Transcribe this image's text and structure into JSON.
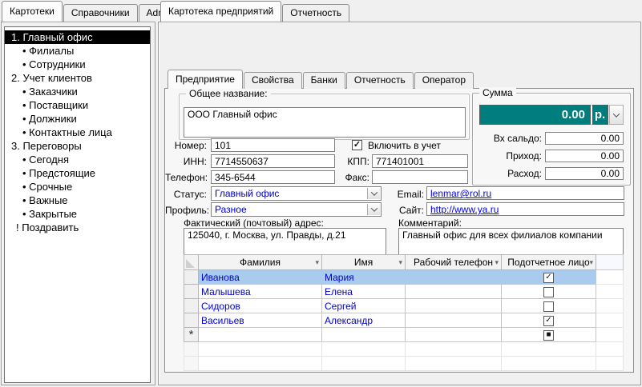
{
  "colors": {
    "accent_teal": "#007d7d",
    "selection_blue": "#a9cbee",
    "value_blue": "#0000cd",
    "link_blue": "#0000ee",
    "tree_selected_bg": "#000000"
  },
  "left_tabs": {
    "items": [
      {
        "label": "Картотеки",
        "active": true
      },
      {
        "label": "Справочники",
        "active": false
      },
      {
        "label": "Admin",
        "active": false
      }
    ]
  },
  "right_tabs": {
    "items": [
      {
        "label": "Картотека предприятий",
        "active": true
      },
      {
        "label": "Отчетность",
        "active": false
      }
    ]
  },
  "tree": {
    "items": [
      {
        "label": "1. Главный офис",
        "selected": true
      },
      {
        "label": "• Филиалы"
      },
      {
        "label": "• Сотрудники"
      },
      {
        "label": "2. Учет клиентов"
      },
      {
        "label": "• Заказчики"
      },
      {
        "label": "• Поставщики"
      },
      {
        "label": "• Должники"
      },
      {
        "label": "• Контактные лица"
      },
      {
        "label": "3. Переговоры"
      },
      {
        "label": "• Сегодня"
      },
      {
        "label": "• Предстоящие"
      },
      {
        "label": "• Срочные"
      },
      {
        "label": "• Важные"
      },
      {
        "label": "• Закрытые"
      },
      {
        "label": "! Поздравить"
      }
    ]
  },
  "inner_tabs": {
    "items": [
      {
        "label": "Предприятие",
        "active": true
      },
      {
        "label": "Свойства",
        "active": false
      },
      {
        "label": "Банки",
        "active": false
      },
      {
        "label": "Отчетность",
        "active": false
      },
      {
        "label": "Оператор",
        "active": false
      }
    ]
  },
  "form": {
    "general_name": {
      "legend": "Общее название:",
      "value": "ООО Главный офис"
    },
    "number": {
      "label": "Номер:",
      "value": "101"
    },
    "include": {
      "label": "Включить в учет",
      "checked": true
    },
    "inn": {
      "label": "ИНН:",
      "value": "7714550637"
    },
    "kpp": {
      "label": "КПП:",
      "value": "771401001"
    },
    "phone": {
      "label": "Телефон:",
      "value": "345-6544"
    },
    "fax": {
      "label": "Факс:",
      "value": ""
    },
    "status": {
      "label": "Статус:",
      "value": "Главный офис"
    },
    "profile": {
      "label": "Профиль:",
      "value": "Разное"
    },
    "email": {
      "label": "Email:",
      "value": "lenmar@rol.ru"
    },
    "site": {
      "label": "Сайт:",
      "value": "http://www.ya.ru"
    },
    "address": {
      "label": "Фактический (почтовый) адрес:",
      "value": "125040, г. Москва, ул. Правды, д.21"
    },
    "comment": {
      "label": "Комментарий:",
      "value": "Главный офис для всех филиалов компании"
    }
  },
  "sum_panel": {
    "legend": "Сумма",
    "total": {
      "value": "0.00",
      "currency": "р."
    },
    "opening_balance": {
      "label": "Вх сальдо:",
      "value": "0.00"
    },
    "income": {
      "label": "Приход:",
      "value": "0.00"
    },
    "expense": {
      "label": "Расход:",
      "value": "0.00"
    }
  },
  "table": {
    "columns": [
      {
        "label": "Фамилия"
      },
      {
        "label": "Имя"
      },
      {
        "label": "Рабочий телефон"
      },
      {
        "label": "Подотчетное лицо"
      }
    ],
    "rows": [
      {
        "last_name": "Иванова",
        "first_name": "Мария",
        "work_phone": "",
        "accountable": true,
        "selected": true
      },
      {
        "last_name": "Малышева",
        "first_name": "Елена",
        "work_phone": "",
        "accountable": false
      },
      {
        "last_name": "Сидоров",
        "first_name": "Сергей",
        "work_phone": "",
        "accountable": false
      },
      {
        "last_name": "Васильев",
        "first_name": "Александр",
        "work_phone": "",
        "accountable": true
      }
    ],
    "new_row": {
      "marker": "*",
      "accountable": "indeterminate"
    }
  },
  "icons": {
    "sort_arrow": "▾"
  }
}
